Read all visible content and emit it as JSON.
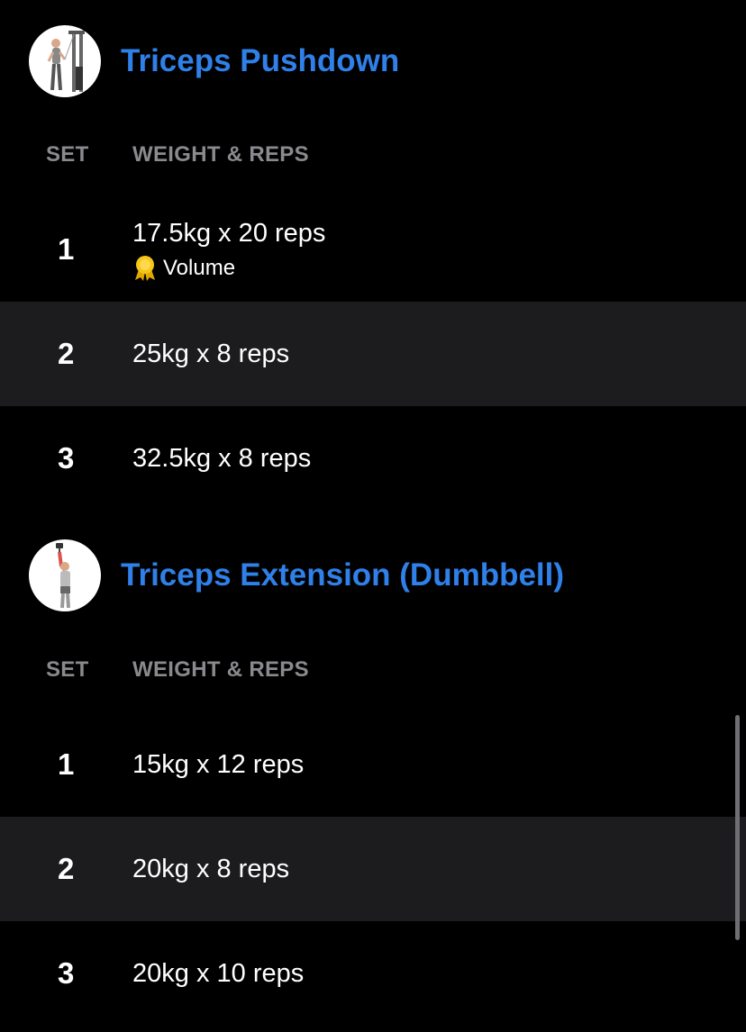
{
  "exercises": [
    {
      "title": "Triceps Pushdown",
      "thumbnail_icon": "triceps-pushdown-illustration",
      "columns": {
        "set": "SET",
        "weight_reps": "WEIGHT & REPS"
      },
      "sets": [
        {
          "number": "1",
          "value": "17.5kg x 20 reps",
          "badge": "Volume",
          "badge_icon": "medal-icon"
        },
        {
          "number": "2",
          "value": "25kg x 8 reps"
        },
        {
          "number": "3",
          "value": "32.5kg x 8 reps"
        }
      ]
    },
    {
      "title": "Triceps Extension (Dumbbell)",
      "thumbnail_icon": "triceps-extension-illustration",
      "columns": {
        "set": "SET",
        "weight_reps": "WEIGHT & REPS"
      },
      "sets": [
        {
          "number": "1",
          "value": "15kg x 12 reps"
        },
        {
          "number": "2",
          "value": "20kg x 8 reps"
        },
        {
          "number": "3",
          "value": "20kg x 10 reps"
        }
      ]
    }
  ],
  "colors": {
    "background": "#000000",
    "title": "#2f80e8",
    "column_header": "#8a8a8e",
    "alt_row": "#1c1c1e",
    "medal": "#f5c518"
  }
}
